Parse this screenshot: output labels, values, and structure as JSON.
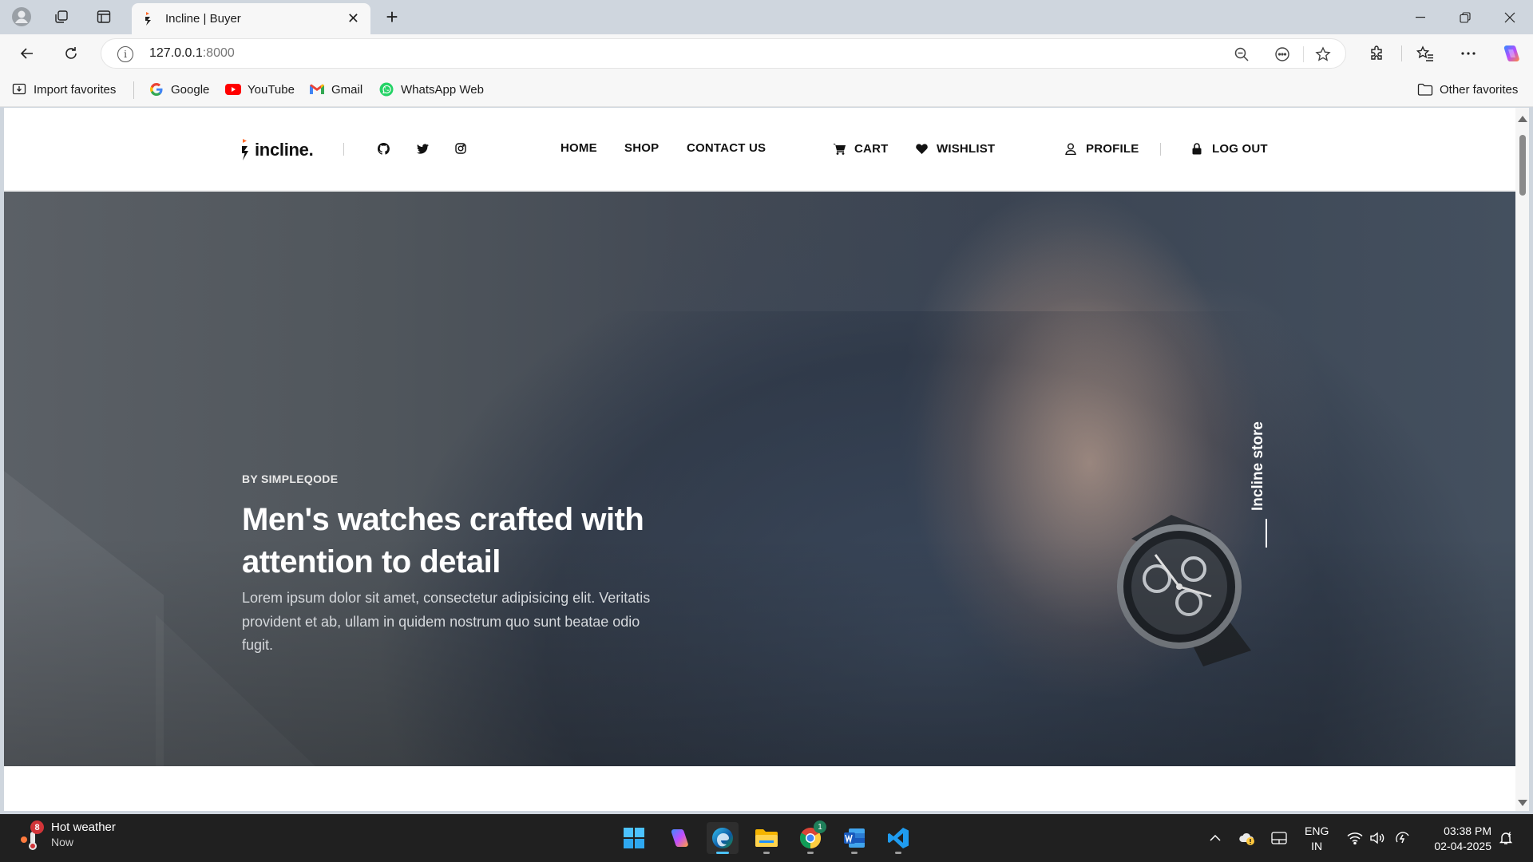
{
  "browser": {
    "tab_title": "Incline | Buyer",
    "address": {
      "host": "127.0.0.1",
      "port": ":8000"
    },
    "favorites": [
      {
        "label": "Import favorites",
        "icon": "import-icon"
      },
      {
        "label": "Google",
        "icon": "google-icon"
      },
      {
        "label": "YouTube",
        "icon": "youtube-icon"
      },
      {
        "label": "Gmail",
        "icon": "gmail-icon"
      },
      {
        "label": "WhatsApp Web",
        "icon": "whatsapp-icon"
      }
    ],
    "other_favorites": "Other favorites"
  },
  "site": {
    "logo": "incline.",
    "nav": {
      "home": "HOME",
      "shop": "SHOP",
      "contact": "CONTACT US",
      "cart": "CART",
      "wishlist": "WISHLIST",
      "profile": "PROFILE",
      "logout": "LOG OUT"
    }
  },
  "hero": {
    "eyebrow": "BY SIMPLEQODE",
    "headline": "Men's watches crafted with attention to detail",
    "lead": "Lorem ipsum dolor sit amet, consectetur adipisicing elit. Veritatis provident et ab, ullam in quidem nostrum quo sunt beatae odio fugit.",
    "vertical_label": "Incline store"
  },
  "taskbar": {
    "weather_badge": "8",
    "weather_title": "Hot weather",
    "weather_sub": "Now",
    "chrome_badge": "1",
    "lang_line1": "ENG",
    "lang_line2": "IN",
    "time": "03:38 PM",
    "date": "02-04-2025"
  },
  "colors": {
    "accent_edge": "#0078d4",
    "brand_orange": "#ff6a2b",
    "taskbar_bg": "#202020"
  }
}
